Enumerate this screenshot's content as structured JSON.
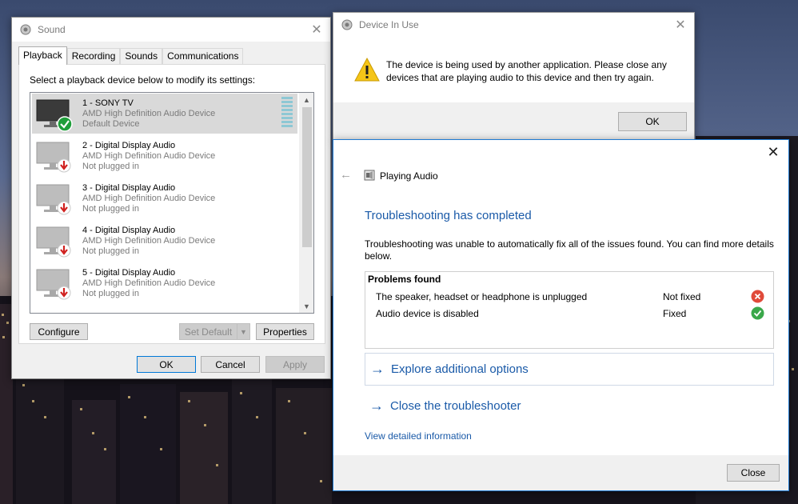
{
  "sound": {
    "title": "Sound",
    "tabs": [
      {
        "label": "Playback"
      },
      {
        "label": "Recording"
      },
      {
        "label": "Sounds"
      },
      {
        "label": "Communications"
      }
    ],
    "instruction": "Select a playback device below to modify its settings:",
    "devices": [
      {
        "name": "1 - SONY TV",
        "driver": "AMD High Definition Audio Device",
        "status": "Default Device",
        "badge": "check-icon"
      },
      {
        "name": "2 - Digital Display Audio",
        "driver": "AMD High Definition Audio Device",
        "status": "Not plugged in",
        "badge": "unplugged-arrow-icon"
      },
      {
        "name": "3 - Digital Display Audio",
        "driver": "AMD High Definition Audio Device",
        "status": "Not plugged in",
        "badge": "unplugged-arrow-icon"
      },
      {
        "name": "4 - Digital Display Audio",
        "driver": "AMD High Definition Audio Device",
        "status": "Not plugged in",
        "badge": "unplugged-arrow-icon"
      },
      {
        "name": "5 - Digital Display Audio",
        "driver": "AMD High Definition Audio Device",
        "status": "Not plugged in",
        "badge": "unplugged-arrow-icon"
      }
    ],
    "buttons": {
      "configure": "Configure",
      "set_default": "Set Default",
      "properties": "Properties",
      "ok": "OK",
      "cancel": "Cancel",
      "apply": "Apply"
    }
  },
  "device_in_use": {
    "title": "Device In Use",
    "message": "The device is being used by another application.  Please close any devices that are playing audio to this device and then try again.",
    "ok": "OK"
  },
  "troubleshooter": {
    "window_title": "Playing Audio",
    "heading": "Troubleshooting has completed",
    "description": "Troubleshooting was unable to automatically fix all of the issues found. You can find more details below.",
    "problems_header": "Problems found",
    "problems": [
      {
        "name": "The speaker, headset or headphone is unplugged",
        "status": "Not fixed",
        "icon": "error-x-icon"
      },
      {
        "name": "Audio device is disabled",
        "status": "Fixed",
        "icon": "success-check-icon"
      }
    ],
    "options": [
      {
        "label": "Explore additional options"
      },
      {
        "label": "Close the troubleshooter"
      }
    ],
    "details_link": "View detailed information",
    "close": "Close"
  },
  "colors": {
    "link_blue": "#1a5aa8",
    "error_red": "#e04a3a",
    "success_green": "#3aa84a",
    "warning_yellow": "#f5c518"
  }
}
